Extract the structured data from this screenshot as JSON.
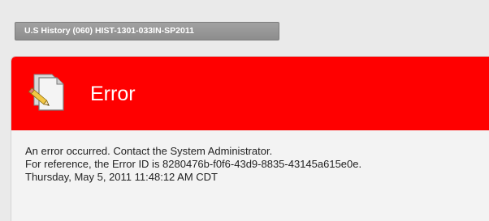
{
  "course": {
    "title": "U.S History (060) HIST-1301-033IN-SP2011"
  },
  "error": {
    "title": "Error",
    "icon": "document-pencil-icon",
    "message_line1": "An error occurred. Contact the System Administrator.",
    "message_line2": "For reference, the Error ID is 8280476b-f0f6-43d9-8835-43145a615e0e.",
    "timestamp": "Thursday, May 5, 2011 11:48:12 AM CDT"
  },
  "colors": {
    "header_red": "#ff0000",
    "tab_gray": "#959595",
    "background": "#eaeaea",
    "panel": "#f3f3f3"
  }
}
